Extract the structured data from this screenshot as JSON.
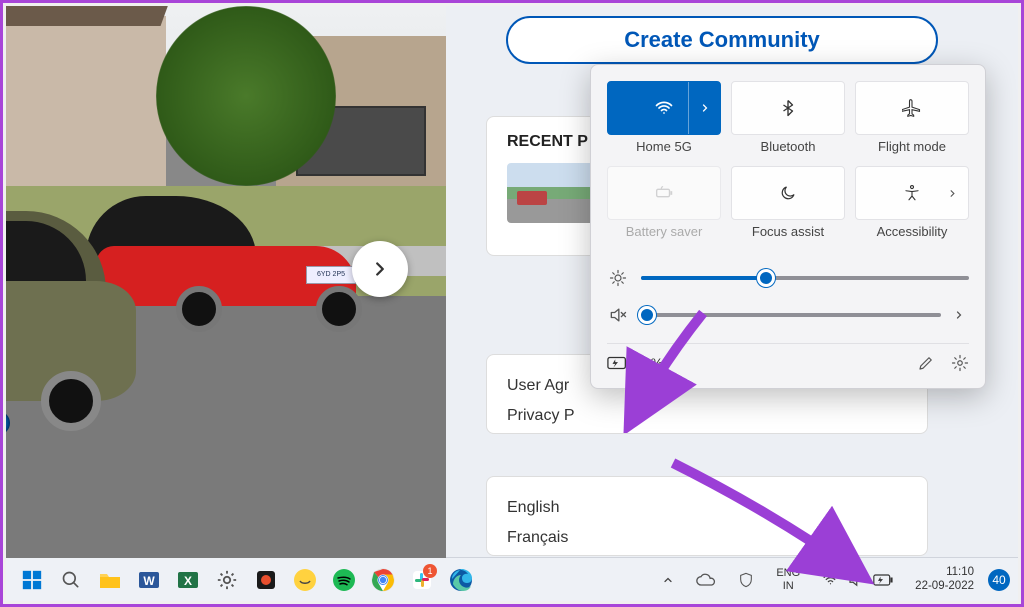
{
  "community": {
    "create_label": "Create Community"
  },
  "recent": {
    "heading": "RECENT P"
  },
  "legal": {
    "agreement": "User Agr",
    "privacy": "Privacy P"
  },
  "lang_links": {
    "en": "English",
    "fr": "Français"
  },
  "quick_settings": {
    "tiles": {
      "wifi": {
        "label": "Home 5G",
        "active": true
      },
      "bluetooth": {
        "label": "Bluetooth",
        "active": false
      },
      "flight": {
        "label": "Flight mode",
        "active": false
      },
      "battery_saver": {
        "label": "Battery saver",
        "disabled": true
      },
      "focus": {
        "label": "Focus assist",
        "active": false
      },
      "accessibility": {
        "label": "Accessibility",
        "active": false
      }
    },
    "brightness": {
      "value": 38
    },
    "volume": {
      "value": 0,
      "muted": true
    },
    "battery": {
      "text": "95%"
    }
  },
  "taskbar": {
    "lang": {
      "line1": "ENG",
      "line2": "IN"
    },
    "clock": {
      "time": "11:10",
      "date": "22-09-2022"
    },
    "notifications": "40",
    "slack_badge": "1"
  }
}
